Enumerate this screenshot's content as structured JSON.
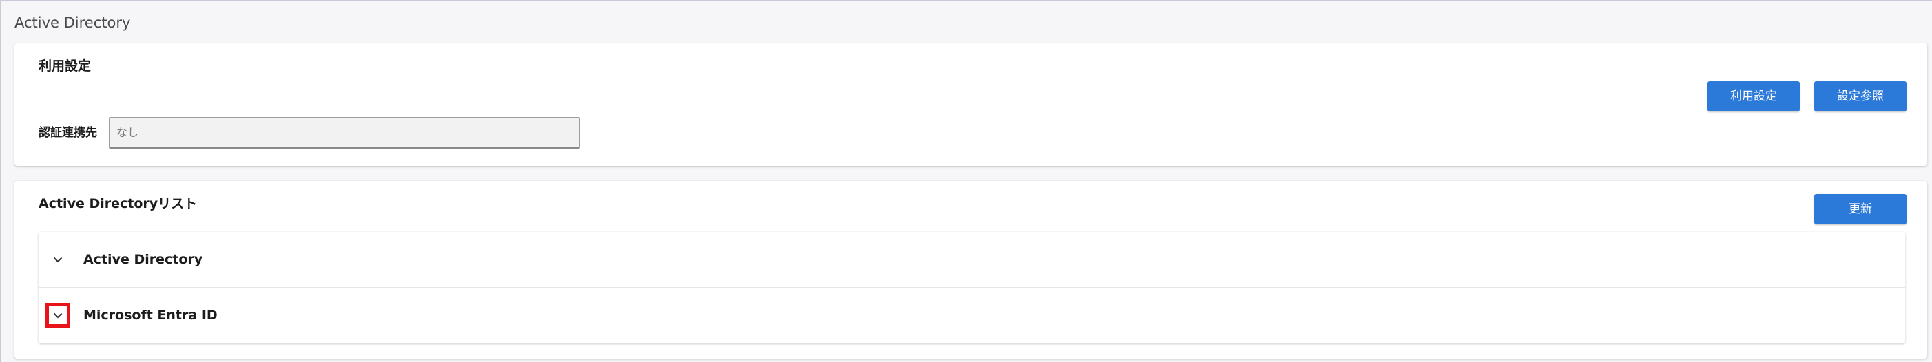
{
  "page": {
    "title": "Active Directory"
  },
  "settings": {
    "title": "利用設定",
    "field_label": "認証連携先",
    "field_placeholder": "なし",
    "usage_button_label": "利用設定",
    "view_button_label": "設定参照"
  },
  "ad_list": {
    "title": "Active Directoryリスト",
    "refresh_button_label": "更新",
    "items": [
      {
        "label": "Active Directory",
        "icon": "chevron-down-icon"
      },
      {
        "label": "Microsoft Entra ID",
        "icon": "chevron-down-icon"
      }
    ]
  },
  "colors": {
    "primary_button": "#2b79d8",
    "highlight_border": "#e8141a"
  }
}
